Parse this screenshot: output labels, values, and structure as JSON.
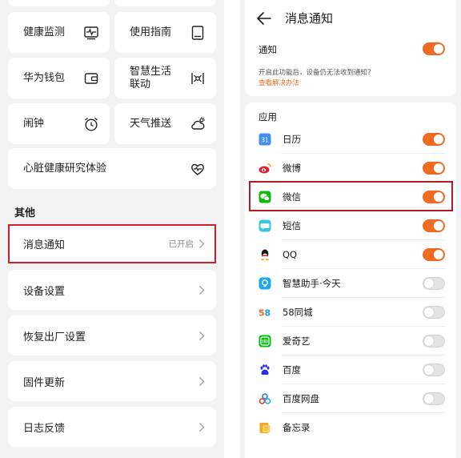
{
  "colors": {
    "accent": "#f06b22",
    "highlight": "#d11f23",
    "toggle_off": "#e3e3e3"
  },
  "settings_screen": {
    "tiles": [
      {
        "label": "健康监测",
        "icon": "health-monitor-icon"
      },
      {
        "label": "使用指南",
        "icon": "guide-book-icon"
      },
      {
        "label": "华为钱包",
        "icon": "wallet-icon"
      },
      {
        "label": "智慧生活联动",
        "icon": "smart-life-icon"
      },
      {
        "label": "闹钟",
        "icon": "alarm-clock-icon"
      },
      {
        "label": "天气推送",
        "icon": "weather-icon"
      },
      {
        "label": "心脏健康研究体验",
        "icon": "heart-research-icon"
      }
    ],
    "section_title": "其他",
    "rows": [
      {
        "label": "消息通知",
        "value": "已开启"
      },
      {
        "label": "设备设置",
        "value": ""
      },
      {
        "label": "恢复出厂设置",
        "value": ""
      },
      {
        "label": "固件更新",
        "value": ""
      },
      {
        "label": "日志反馈",
        "value": ""
      }
    ]
  },
  "notification_screen": {
    "title": "消息通知",
    "master_label": "通知",
    "master_on": true,
    "hint": "开启此功能后，设备仍无法收到通知？",
    "hint_link": "查看解决办法",
    "apps_label": "应用",
    "apps": [
      {
        "name": "日历",
        "icon": "calendar-app-icon",
        "on": true
      },
      {
        "name": "微博",
        "icon": "weibo-app-icon",
        "on": true
      },
      {
        "name": "微信",
        "icon": "wechat-app-icon",
        "on": true
      },
      {
        "name": "短信",
        "icon": "sms-app-icon",
        "on": true
      },
      {
        "name": "QQ",
        "icon": "qq-app-icon",
        "on": true
      },
      {
        "name": "智慧助手·今天",
        "icon": "smart-assistant-app-icon",
        "on": false
      },
      {
        "name": "58同城",
        "icon": "58-app-icon",
        "on": false
      },
      {
        "name": "爱奇艺",
        "icon": "iqiyi-app-icon",
        "on": false
      },
      {
        "name": "百度",
        "icon": "baidu-app-icon",
        "on": false
      },
      {
        "name": "百度网盘",
        "icon": "baidu-netdisk-app-icon",
        "on": false
      },
      {
        "name": "备忘录",
        "icon": "memo-app-icon",
        "on": null
      }
    ]
  }
}
